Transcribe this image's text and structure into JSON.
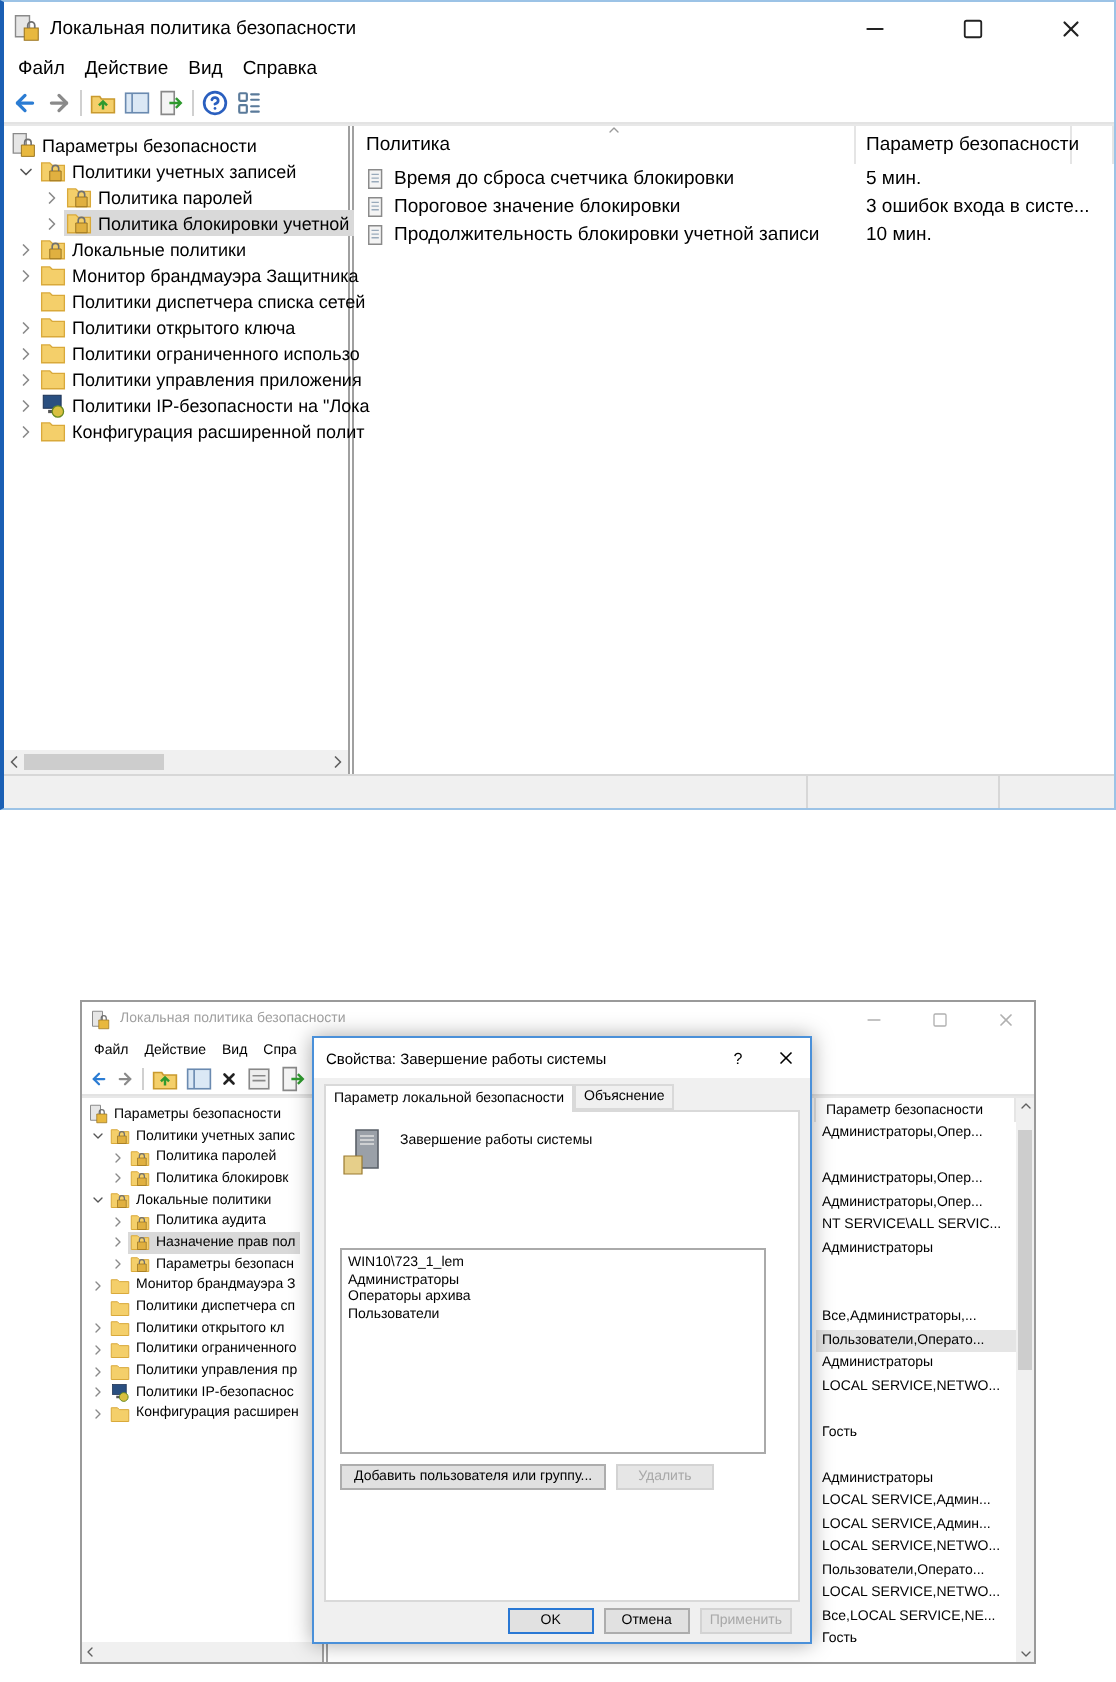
{
  "top_window": {
    "title": "Локальная политика безопасности",
    "active": true,
    "menu": [
      "Файл",
      "Действие",
      "Вид",
      "Справка"
    ],
    "tree": [
      {
        "label": "Параметры безопасности",
        "kind": "security",
        "selected": false,
        "children": [
          {
            "label": "Политики учетных записей",
            "kind": "folder-lock",
            "expanded": true,
            "selected": false,
            "children": [
              {
                "label": "Политика паролей",
                "kind": "folder-lock",
                "expanded": false,
                "selected": false
              },
              {
                "label": "Политика блокировки учетной",
                "kind": "folder-lock",
                "expanded": false,
                "selected": true
              }
            ]
          },
          {
            "label": "Локальные политики",
            "kind": "folder-lock",
            "expanded": false,
            "selected": false
          },
          {
            "label": "Монитор брандмауэра Защитника",
            "kind": "folder",
            "expanded": false,
            "selected": false
          },
          {
            "label": "Политики диспетчера списка сетей",
            "kind": "folder",
            "selected": false
          },
          {
            "label": "Политики открытого ключа",
            "kind": "folder",
            "expanded": false,
            "selected": false
          },
          {
            "label": "Политики ограниченного использо",
            "kind": "folder",
            "expanded": false,
            "selected": false
          },
          {
            "label": "Политики управления приложения",
            "kind": "folder",
            "expanded": false,
            "selected": false
          },
          {
            "label": "Политики IP-безопасности на \"Лока",
            "kind": "ip",
            "expanded": false,
            "selected": false
          },
          {
            "label": "Конфигурация расширенной полит",
            "kind": "folder",
            "expanded": false,
            "selected": false
          }
        ]
      }
    ],
    "table": {
      "columns": [
        "Политика",
        "Параметр безопасности"
      ],
      "rows": [
        {
          "policy": "Время до сброса счетчика блокировки",
          "value": "5 мин."
        },
        {
          "policy": "Пороговое значение блокировки",
          "value": "3 ошибок входа в систе..."
        },
        {
          "policy": "Продолжительность блокировки учетной записи",
          "value": "10 мин."
        }
      ]
    }
  },
  "bottom_window": {
    "title": "Локальная политика безопасности",
    "active": false,
    "menu": [
      "Файл",
      "Действие",
      "Вид",
      "Спра"
    ],
    "tree": [
      {
        "label": "Параметры безопасности",
        "kind": "security",
        "selected": false,
        "children": [
          {
            "label": "Политики учетных запис",
            "kind": "folder-lock",
            "expanded": true,
            "selected": false,
            "children": [
              {
                "label": "Политика паролей",
                "kind": "folder-lock",
                "expanded": false,
                "selected": false
              },
              {
                "label": "Политика блокировк",
                "kind": "folder-lock",
                "expanded": false,
                "selected": false
              }
            ]
          },
          {
            "label": "Локальные политики",
            "kind": "folder-lock",
            "expanded": true,
            "selected": false,
            "children": [
              {
                "label": "Политика аудита",
                "kind": "folder-lock",
                "expanded": false,
                "selected": false
              },
              {
                "label": "Назначение прав пол",
                "kind": "folder-lock",
                "expanded": false,
                "selected": true
              },
              {
                "label": "Параметры безопасн",
                "kind": "folder-lock",
                "expanded": false,
                "selected": false
              }
            ]
          },
          {
            "label": "Монитор брандмауэра З",
            "kind": "folder",
            "expanded": false,
            "selected": false
          },
          {
            "label": "Политики диспетчера сп",
            "kind": "folder",
            "selected": false
          },
          {
            "label": "Политики открытого кл",
            "kind": "folder",
            "expanded": false,
            "selected": false
          },
          {
            "label": "Политики ограниченного",
            "kind": "folder",
            "expanded": false,
            "selected": false
          },
          {
            "label": "Политики управления пр",
            "kind": "folder",
            "expanded": false,
            "selected": false
          },
          {
            "label": "Политики IP-безопаснос",
            "kind": "ip",
            "expanded": false,
            "selected": false
          },
          {
            "label": "Конфигурация расширен",
            "kind": "folder",
            "expanded": false,
            "selected": false
          }
        ]
      }
    ],
    "table": {
      "column": "Параметр безопасности",
      "rows": [
        {
          "kind": "value",
          "text": "Администраторы,Опер...",
          "selected": false
        },
        {
          "kind": "empty",
          "selected": false
        },
        {
          "kind": "value",
          "text": "Администраторы,Опер...",
          "selected": false
        },
        {
          "kind": "value",
          "text": "Администраторы,Опер...",
          "selected": false
        },
        {
          "kind": "value",
          "text": "NT SERVICE\\ALL SERVIC...",
          "selected": false
        },
        {
          "kind": "value",
          "text": "Администраторы",
          "selected": false
        },
        {
          "kind": "empty",
          "selected": false
        },
        {
          "kind": "empty",
          "selected": false
        },
        {
          "kind": "value",
          "text": "Все,Администраторы,...",
          "selected": false
        },
        {
          "kind": "value",
          "text": "Пользователи,Операто...",
          "selected": true
        },
        {
          "kind": "value",
          "text": "Администраторы",
          "selected": false
        },
        {
          "kind": "value",
          "text": "LOCAL SERVICE,NETWO...",
          "selected": false
        },
        {
          "kind": "empty",
          "selected": false
        },
        {
          "kind": "value",
          "text": "Гость",
          "selected": false
        },
        {
          "kind": "empty",
          "selected": false
        },
        {
          "kind": "value",
          "text": "Администраторы",
          "selected": false
        },
        {
          "kind": "value",
          "text": "LOCAL SERVICE,Админ...",
          "selected": false
        },
        {
          "kind": "value",
          "text": "LOCAL SERVICE,Админ...",
          "selected": false
        },
        {
          "kind": "value",
          "text": "LOCAL SERVICE,NETWO...",
          "selected": false
        },
        {
          "kind": "value",
          "text": "Пользователи,Операто...",
          "selected": false
        },
        {
          "kind": "value",
          "text": "LOCAL SERVICE,NETWO...",
          "selected": false
        },
        {
          "kind": "value",
          "text": "Все,LOCAL SERVICE,NE...",
          "selected": false
        },
        {
          "kind": "value",
          "text": "Гость",
          "selected": false
        }
      ]
    },
    "dialog": {
      "title": "Свойства: Завершение работы системы",
      "help_button": "?",
      "tabs": [
        {
          "label": "Параметр локальной безопасности",
          "selected": true
        },
        {
          "label": "Объяснение",
          "selected": false
        }
      ],
      "policy_name": "Завершение работы системы",
      "members": [
        "WIN10\\723_1_lem",
        "Администраторы",
        "Операторы архива",
        "Пользователи"
      ],
      "member_buttons": [
        {
          "label": "Добавить пользователя или группу...",
          "disabled": false
        },
        {
          "label": "Удалить",
          "disabled": true
        }
      ],
      "buttons": [
        {
          "label": "OK",
          "disabled": false,
          "default": true
        },
        {
          "label": "Отмена",
          "disabled": false,
          "default": false
        },
        {
          "label": "Применить",
          "disabled": true,
          "default": false
        }
      ]
    }
  }
}
